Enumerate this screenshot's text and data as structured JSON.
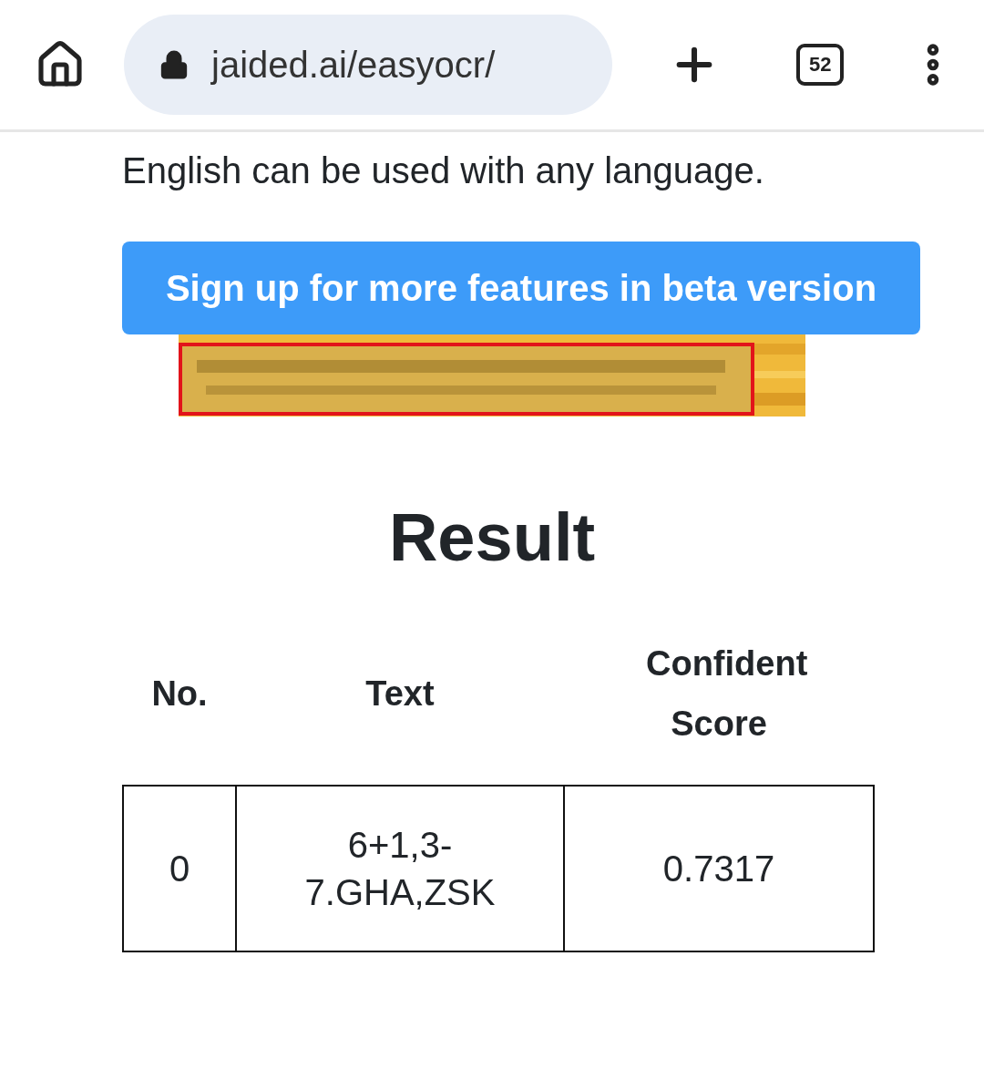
{
  "browser": {
    "url": "jaided.ai/easyocr/",
    "tab_count": "52"
  },
  "intro": "English can be used with any language.",
  "signup_button": "Sign up for more features in beta version",
  "result": {
    "title": "Result",
    "columns": [
      "No.",
      "Text",
      "Confident Score"
    ],
    "rows": [
      [
        "0",
        "6+1,3-7.GHA,ZSK",
        "0.7317"
      ]
    ]
  }
}
